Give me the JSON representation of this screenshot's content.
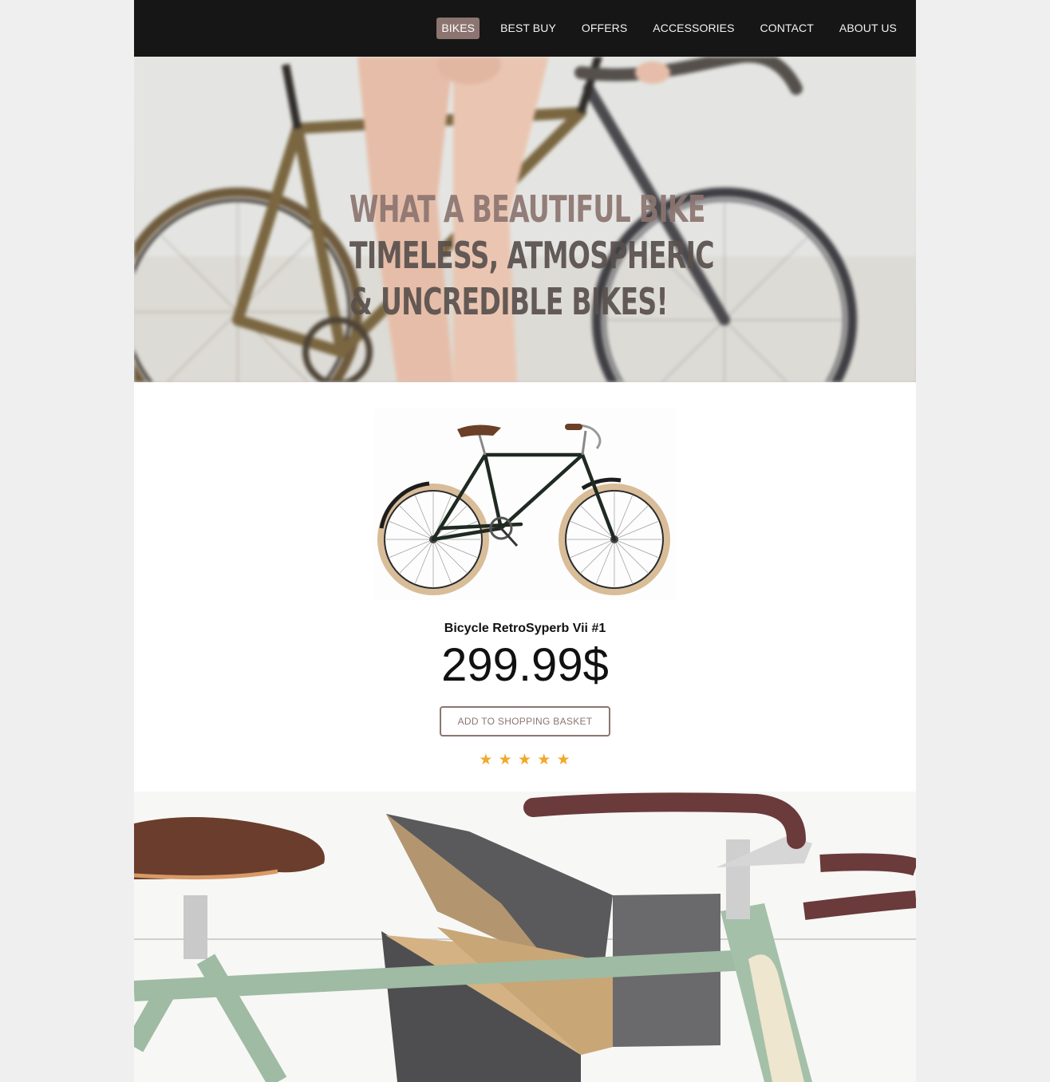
{
  "nav": {
    "items": [
      {
        "label": "BIKES",
        "active": true
      },
      {
        "label": "BEST BUY",
        "active": false
      },
      {
        "label": "OFFERS",
        "active": false
      },
      {
        "label": "ACCESSORIES",
        "active": false
      },
      {
        "label": "CONTACT",
        "active": false
      },
      {
        "label": "ABOUT US",
        "active": false
      }
    ]
  },
  "hero": {
    "line1": "WHAT A BEAUTIFUL BIKE",
    "line2": "TIMELESS, ATMOSPHERIC",
    "line3": "& UNCREDIBLE BIKES!"
  },
  "product": {
    "name": "Bicycle RetroSyperb Vii #1",
    "price": "299.99$",
    "button_label": "ADD TO SHOPPING BASKET",
    "rating": 5,
    "stars": [
      "★",
      "★",
      "★",
      "★",
      "★"
    ]
  },
  "colors": {
    "accent": "#8c7570",
    "header_bg": "#161616",
    "star": "#f0a92c"
  }
}
